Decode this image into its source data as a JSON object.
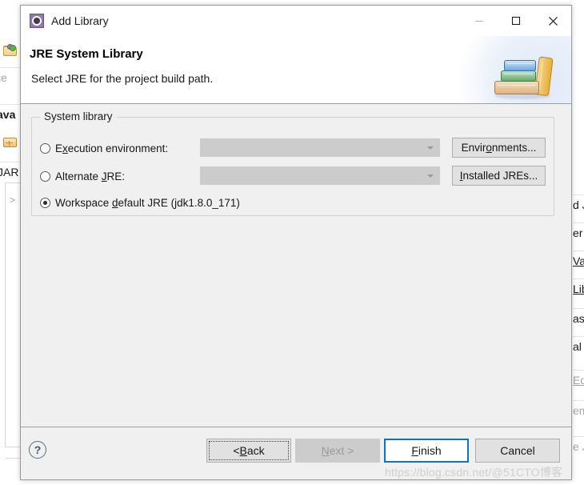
{
  "window": {
    "title": "Add Library",
    "icon": "library-gear-icon",
    "minimize_label": "—",
    "maximize_label": "□",
    "close_label": "✕"
  },
  "header": {
    "title": "JRE System Library",
    "description": "Select JRE for the project build path.",
    "banner_icon": "book-stack-icon"
  },
  "group": {
    "legend": "System library",
    "options": [
      {
        "id": "execution-environment",
        "label_before": "E",
        "label_mnemonic": "x",
        "label_after": "ecution environment:",
        "full_label": "Execution environment:",
        "selected": false,
        "combo_value": "",
        "button": {
          "before": "Envir",
          "mnemonic": "o",
          "after": "nments...",
          "full": "Environments..."
        }
      },
      {
        "id": "alternate-jre",
        "label_before": "Alternate ",
        "label_mnemonic": "J",
        "label_after": "RE:",
        "full_label": "Alternate JRE:",
        "selected": false,
        "combo_value": "",
        "button": {
          "before": "",
          "mnemonic": "I",
          "after": "nstalled JREs...",
          "full": "Installed JREs..."
        }
      },
      {
        "id": "workspace-default-jre",
        "label_before": "Workspace ",
        "label_mnemonic": "d",
        "label_after": "efault JRE (jdk1.8.0_171)",
        "full_label": "Workspace default JRE (jdk1.8.0_171)",
        "selected": true
      }
    ]
  },
  "buttonbar": {
    "help_label": "?",
    "back": {
      "before": "< ",
      "mnemonic": "B",
      "after": "ack",
      "full": "< Back"
    },
    "next": {
      "before": "",
      "mnemonic": "N",
      "after": "ext >",
      "full": "Next >"
    },
    "finish": {
      "before": "",
      "mnemonic": "F",
      "after": "inish",
      "full": "Finish"
    },
    "cancel": {
      "full": "Cancel"
    }
  },
  "watermark": "https://blog.csdn.net/@51CTO博客",
  "background": {
    "left_items": [
      {
        "text": "vice",
        "dim": true
      },
      {
        "text": "ava",
        "bold": true
      },
      {
        "text": "JAR",
        "dim": false
      },
      {
        "text": ">",
        "dim": true
      }
    ],
    "right_items": [
      {
        "text": "d J",
        "underline": "J"
      },
      {
        "text": "er"
      },
      {
        "text": "Va",
        "underline": "V"
      },
      {
        "text": "Lib",
        "underline": "L"
      },
      {
        "text": "ass"
      },
      {
        "text": "al ("
      },
      {
        "text": "Edi",
        "dim": true
      },
      {
        "text": "em",
        "dim": true
      },
      {
        "text": "e J",
        "dim": true
      }
    ]
  },
  "colors": {
    "accent": "#0a74cb",
    "dialog_bg": "#f0f0f0",
    "header_bg": "#ffffff",
    "disabled": "#cccccc"
  }
}
